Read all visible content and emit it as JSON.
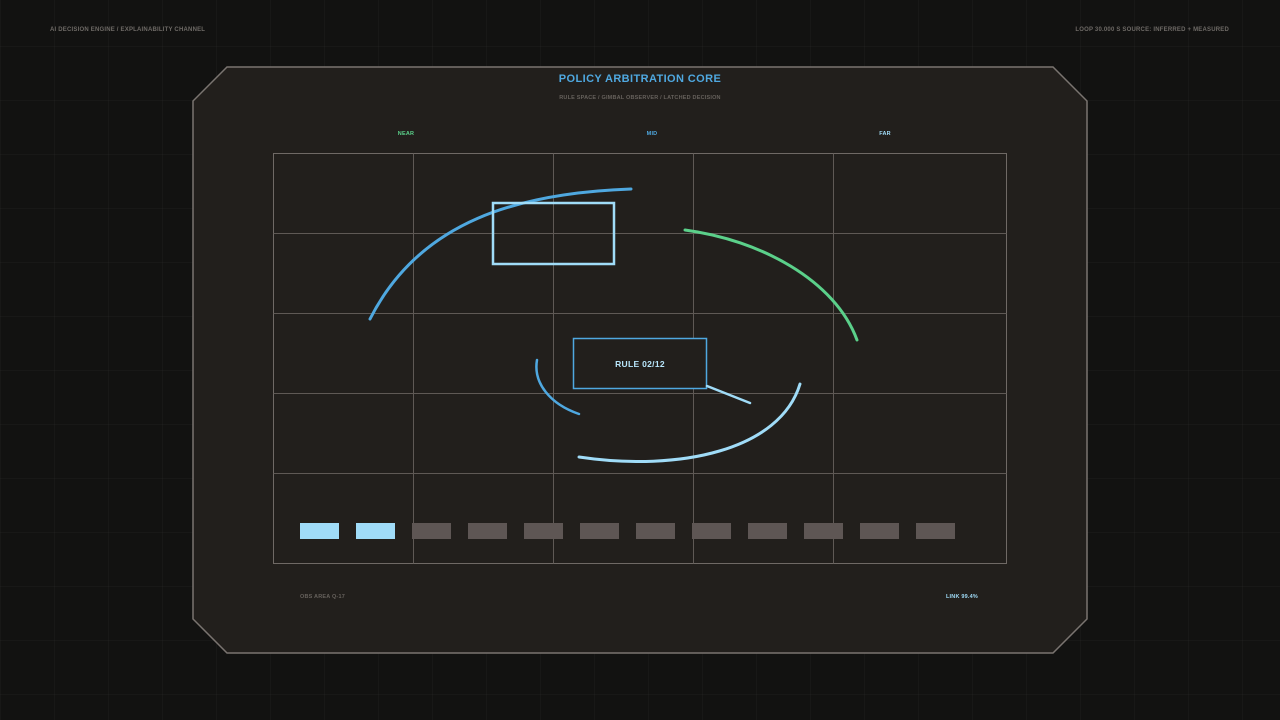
{
  "header": {
    "left_label": "AI DECISION ENGINE / EXPLAINABILITY CHANNEL",
    "right_label": "LOOP 30.000 S   SOURCE: INFERRED + MEASURED"
  },
  "panel": {
    "title": "POLICY ARBITRATION CORE",
    "subtitle": "RULE SPACE / GIMBAL OBSERVER / LATCHED DECISION",
    "zones": {
      "near": "NEAR",
      "mid": "MID",
      "far": "FAR"
    },
    "rule_label": "RULE 02/12",
    "rule_progress": {
      "active": 2,
      "total": 12
    },
    "footer_left": "OBS AREA Q-17",
    "footer_right": "LINK 99.4%"
  },
  "colors": {
    "background": "#121211",
    "panel_fill": "#221f1c",
    "panel_border": "#7a7470",
    "grid": "#5f5955",
    "accent_blue": "#4fa8e0",
    "accent_light_blue": "#a0dcf8",
    "accent_green": "#5bd08a",
    "segment_inactive": "#5e5654"
  }
}
